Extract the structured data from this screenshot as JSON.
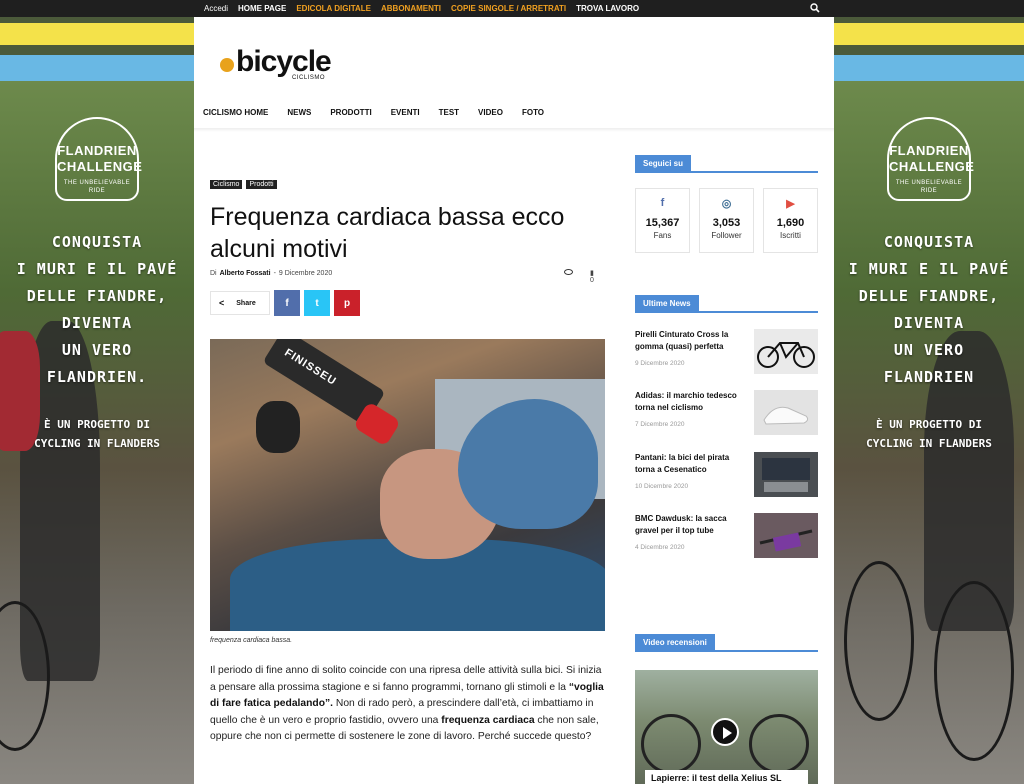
{
  "topbar": {
    "items": [
      "Accedi",
      "HOME PAGE",
      "EDICOLA DIGITALE",
      "ABBONAMENTI",
      "COPIE SINGOLE / ARRETRATI",
      "TROVA LAVORO"
    ],
    "colors": [
      "#ffffff",
      "#ffffff",
      "#f0a020",
      "#f0a020",
      "#f0a020",
      "#ffffff"
    ],
    "search_icon": "search-icon"
  },
  "banner": {
    "badge_line1": "FLANDRIEN",
    "badge_line2": "CHALLENGE",
    "badge_tagline": "THE UNBELIEVABLE RIDE",
    "claim": [
      "CONQUISTA",
      "I MURI E IL PAVÉ",
      "DELLE FIANDRE,",
      "DIVENTA",
      "UN VERO",
      "FLANDRIEN."
    ],
    "claim_right": [
      "CONQUISTA",
      "I MURI E IL PAVÉ",
      "DELLE FIANDRE,",
      "DIVENTA",
      "UN VERO",
      "FLANDRIEN"
    ],
    "sub": [
      "È UN PROGETTO DI",
      "CYCLING IN FLANDERS"
    ]
  },
  "logo": {
    "word": "bicycle",
    "tag": "CICLISMO"
  },
  "nav": [
    "CICLISMO HOME",
    "NEWS",
    "PRODOTTI",
    "EVENTI",
    "TEST",
    "VIDEO",
    "FOTO"
  ],
  "article": {
    "tags": [
      "Ciclismo",
      "Prodotti"
    ],
    "title": "Frequenza cardiaca bassa ecco alcuni motivi",
    "meta_by": "Di",
    "author": "Alberto Fossati",
    "sep": "-",
    "date": "9 Dicembre 2020",
    "comments": "0",
    "share_label": "Share",
    "share_buttons": [
      {
        "icon": "facebook-icon",
        "glyph": "f",
        "color": "#516eab"
      },
      {
        "icon": "twitter-icon",
        "glyph": "t",
        "color": "#29c5f6"
      },
      {
        "icon": "pinterest-icon",
        "glyph": "p",
        "color": "#ca212a"
      }
    ],
    "image_text": "FINISSEU",
    "caption": "frequenza cardiaca bassa.",
    "body_1": "Il periodo di fine anno di solito coincide con una ripresa delle attività sulla bici. Si inizia a pensare alla prossima stagione e si fanno programmi, tornano gli stimoli e la ",
    "body_bold1": "“voglia di fare fatica pedalando”.",
    "body_2": " Non di rado però, a prescindere dall’età, ci imbattiamo in quello che è un vero e proprio fastidio, ovvero una ",
    "body_bold2": "frequenza cardiaca",
    "body_3": " che non sale, oppure che non ci permette di sostenere le zone di lavoro. Perché succede questo?"
  },
  "sidebar": {
    "follow_title": "Seguici su",
    "social": [
      {
        "icon": "facebook-icon",
        "glyph": "f",
        "color": "#516eab",
        "count": "15,367",
        "label": "Fans"
      },
      {
        "icon": "instagram-icon",
        "glyph": "◎",
        "color": "#417096",
        "count": "3,053",
        "label": "Follower"
      },
      {
        "icon": "youtube-icon",
        "glyph": "▶",
        "color": "#e14e42",
        "count": "1,690",
        "label": "Iscritti"
      }
    ],
    "news_title": "Ultime News",
    "news": [
      {
        "title": "Pirelli Cinturato Cross la gomma (quasi) perfetta",
        "date": "9 Dicembre 2020",
        "thumb": "#e9e9e9"
      },
      {
        "title": "Adidas: il marchio tedesco torna nel ciclismo",
        "date": "7 Dicembre 2020",
        "thumb": "#dcdcdc"
      },
      {
        "title": "Pantani: la bici del pirata torna a Cesenatico",
        "date": "10 Dicembre 2020",
        "thumb": "#4a4e52"
      },
      {
        "title": "BMC Dawdusk: la sacca gravel per il top tube",
        "date": "4 Dicembre 2020",
        "thumb": "#6a5a60"
      }
    ],
    "video_title": "Video recensioni",
    "video_caption": "Lapierre: il test della Xelius SL"
  }
}
